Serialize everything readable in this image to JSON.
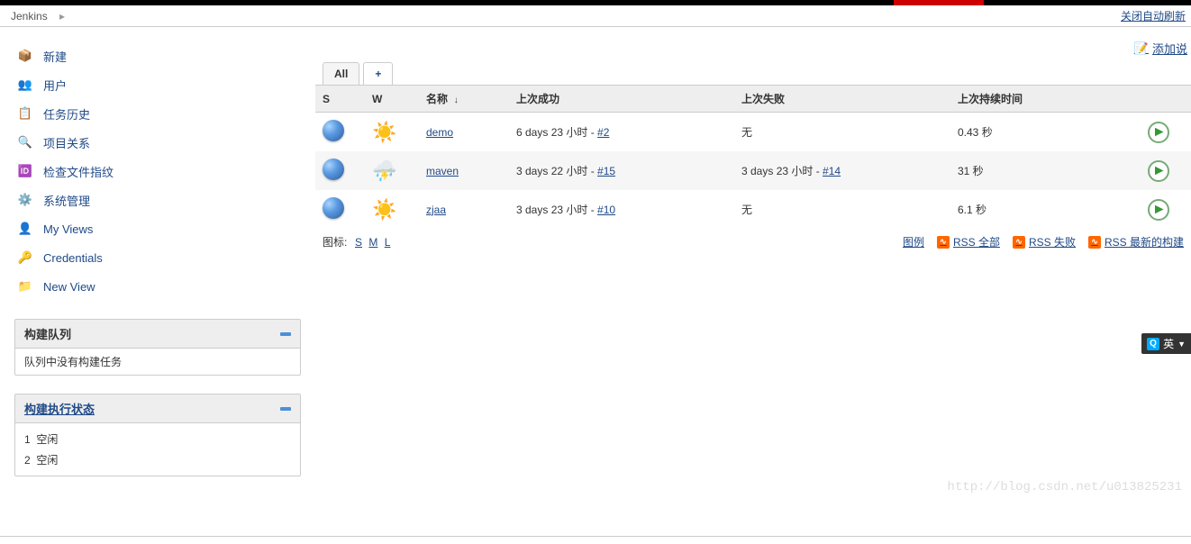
{
  "breadcrumb": {
    "root": "Jenkins",
    "autoRefresh": "关闭自动刷新"
  },
  "addDescription": "添加说",
  "sidebar": {
    "tasks": [
      {
        "label": "新建",
        "icon": "package-icon"
      },
      {
        "label": "用户",
        "icon": "users-icon"
      },
      {
        "label": "任务历史",
        "icon": "history-icon"
      },
      {
        "label": "项目关系",
        "icon": "search-icon"
      },
      {
        "label": "检查文件指纹",
        "icon": "fingerprint-icon"
      },
      {
        "label": "系统管理",
        "icon": "gear-icon"
      },
      {
        "label": "My Views",
        "icon": "user-icon"
      },
      {
        "label": "Credentials",
        "icon": "credentials-icon"
      },
      {
        "label": "New View",
        "icon": "newfolder-icon"
      }
    ],
    "queue": {
      "title": "构建队列",
      "empty": "队列中没有构建任务"
    },
    "executors": {
      "title": "构建执行状态",
      "rows": [
        {
          "num": "1",
          "state": "空闲"
        },
        {
          "num": "2",
          "state": "空闲"
        }
      ]
    }
  },
  "tabs": {
    "all": "All",
    "plus": "+"
  },
  "columns": {
    "s": "S",
    "w": "W",
    "name": "名称",
    "sort": "↓",
    "lastSuccess": "上次成功",
    "lastFailure": "上次失败",
    "lastDuration": "上次持续时间"
  },
  "jobs": [
    {
      "name": "demo",
      "weather": "sun",
      "lastSuccess": "6 days 23 小时",
      "succBuild": "#2",
      "lastFailure": "无",
      "failBuild": "",
      "duration": "0.43 秒"
    },
    {
      "name": "maven",
      "weather": "storm",
      "lastSuccess": "3 days 22 小时",
      "succBuild": "#15",
      "lastFailure": "3 days 23 小时",
      "failBuild": "#14",
      "duration": "31 秒"
    },
    {
      "name": "zjaa",
      "weather": "sun",
      "lastSuccess": "3 days 23 小时",
      "succBuild": "#10",
      "lastFailure": "无",
      "failBuild": "",
      "duration": "6.1 秒"
    }
  ],
  "iconSize": {
    "label": "图标:",
    "s": "S",
    "m": "M",
    "l": "L"
  },
  "rss": {
    "legend": "图例",
    "all": "RSS 全部",
    "fail": "RSS 失败",
    "latest": "RSS 最新的构建"
  },
  "watermark": "http://blog.csdn.net/u013825231",
  "ime": "英"
}
